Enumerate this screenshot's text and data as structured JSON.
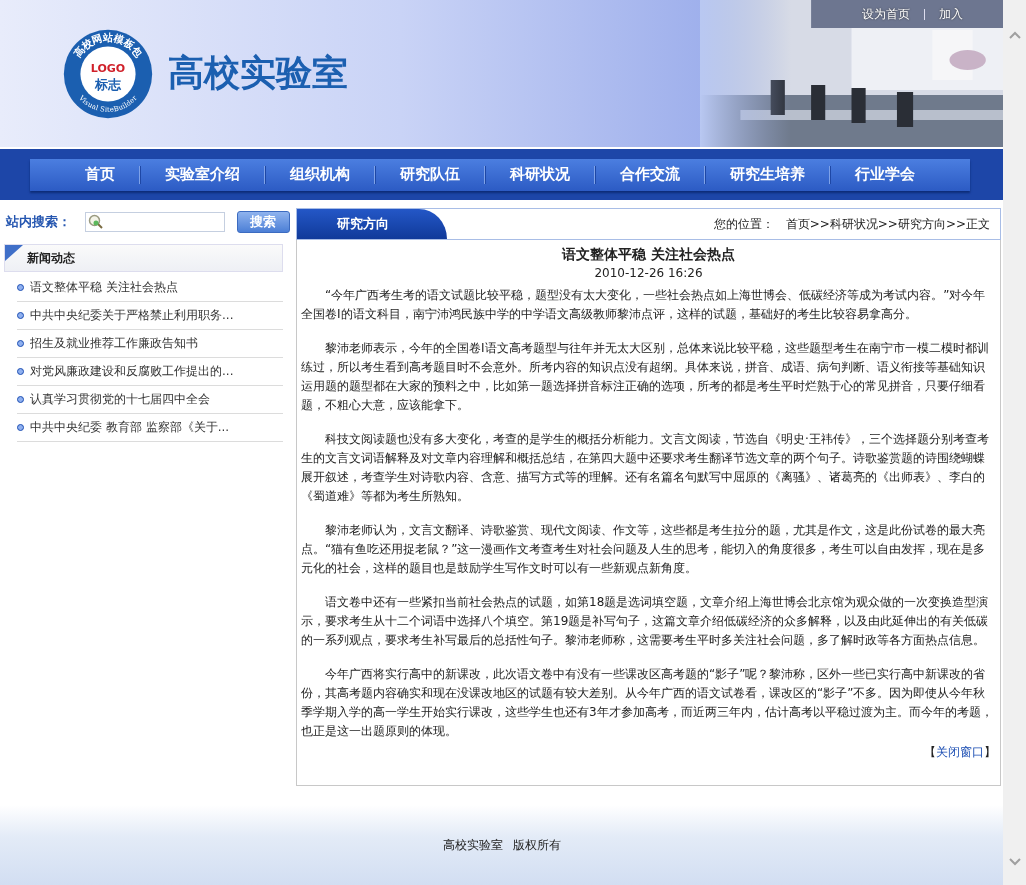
{
  "header": {
    "logo": {
      "arc_top": "高校网站模板包",
      "arc_bottom": "Visual SiteBuilder",
      "mark": "LOGO",
      "sub": "标志"
    },
    "site_title": "高校实验室",
    "top_links": [
      "设为首页",
      "加入"
    ]
  },
  "nav": [
    "首页",
    "实验室介绍",
    "组织机构",
    "研究队伍",
    "科研状况",
    "合作交流",
    "研究生培养",
    "行业学会"
  ],
  "search": {
    "label": "站内搜索：",
    "button": "搜索"
  },
  "news": {
    "title": "新闻动态",
    "items": [
      "语文整体平稳 关注社会热点",
      "中共中央纪委关于严格禁止利用职务...",
      "招生及就业推荐工作廉政告知书",
      "对党风廉政建设和反腐败工作提出的...",
      "认真学习贯彻党的十七届四中全会",
      "中共中央纪委 教育部 监察部《关于..."
    ]
  },
  "section_tab": "研究方向",
  "breadcrumb": {
    "label": "您的位置：",
    "path": "首页>>科研状况>>研究方向>>正文"
  },
  "article": {
    "title": "语文整体平稳 关注社会热点",
    "date": "2010-12-26 16:26",
    "paragraphs": [
      "“今年广西考生考的语文试题比较平稳，题型没有太大变化，一些社会热点如上海世博会、低碳经济等成为考试内容。”对今年全国卷Ⅰ的语文科目，南宁沛鸿民族中学的中学语文高级教师黎沛点评，这样的试题，基础好的考生比较容易拿高分。",
      "黎沛老师表示，今年的全国卷Ⅰ语文高考题型与往年并无太大区别，总体来说比较平稳，这些题型考生在南宁市一模二模时都训练过，所以考生看到高考题目时不会意外。所考内容的知识点没有超纲。具体来说，拼音、成语、病句判断、语义衔接等基础知识运用题的题型都在大家的预料之中，比如第一题选择拼音标注正确的选项，所考的都是考生平时烂熟于心的常见拼音，只要仔细看题，不粗心大意，应该能拿下。",
      "科技文阅读题也没有多大变化，考查的是学生的概括分析能力。文言文阅读，节选自《明史·王祎传》，三个选择题分别考查考生的文言文词语解释及对文章内容理解和概括总结，在第四大题中还要求考生翻译节选文章的两个句子。诗歌鉴赏题的诗围绕蝴蝶展开叙述，考查学生对诗歌内容、含意、描写方式等的理解。还有名篇名句默写中屈原的《离骚》、诸葛亮的《出师表》、李白的《蜀道难》等都为考生所熟知。",
      "黎沛老师认为，文言文翻译、诗歌鉴赏、现代文阅读、作文等，这些都是考生拉分的题，尤其是作文，这是此份试卷的最大亮点。“猫有鱼吃还用捉老鼠？”这一漫画作文考查考生对社会问题及人生的思考，能切入的角度很多，考生可以自由发挥，现在是多元化的社会，这样的题目也是鼓励学生写作文时可以有一些新观点新角度。",
      "语文卷中还有一些紧扣当前社会热点的试题，如第18题是选词填空题，文章介绍上海世博会北京馆为观众做的一次变换造型演示，要求考生从十二个词语中选择八个填空。第19题是补写句子，这篇文章介绍低碳经济的众多解释，以及由此延伸出的有关低碳的一系列观点，要求考生补写最后的总括性句子。黎沛老师称，这需要考生平时多关注社会问题，多了解时政等各方面热点信息。",
      "今年广西将实行高中的新课改，此次语文卷中有没有一些课改区高考题的“影子”呢？黎沛称，区外一些已实行高中新课改的省份，其高考题内容确实和现在没课改地区的试题有较大差别。从今年广西的语文试卷看，课改区的“影子”不多。因为即使从今年秋季学期入学的高一学生开始实行课改，这些学生也还有3年才参加高考，而近两三年内，估计高考以平稳过渡为主。而今年的考题，也正是这一出题原则的体现。"
    ],
    "close_brackets": [
      "【",
      "】"
    ],
    "close_link": "关闭窗口"
  },
  "footer": [
    "高校实验室",
    "版权所有"
  ]
}
